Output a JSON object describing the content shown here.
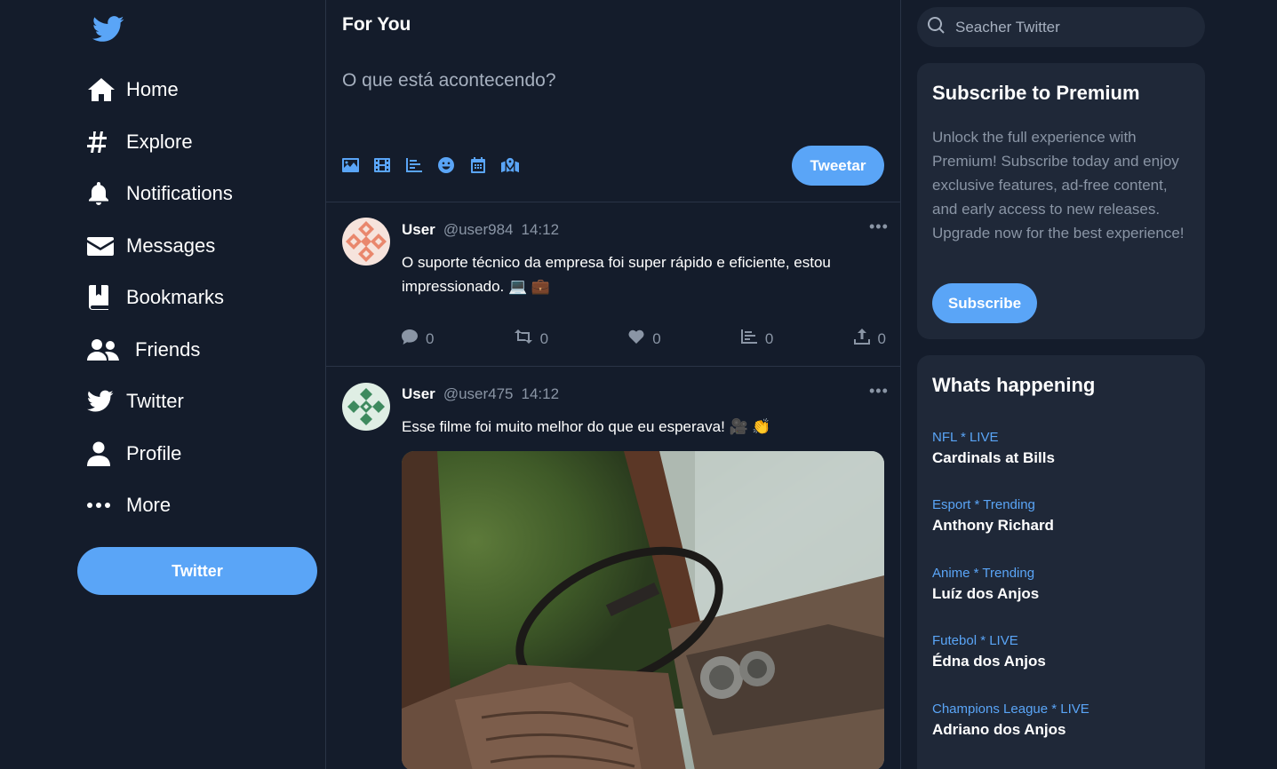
{
  "sidebar": {
    "items": [
      {
        "label": "Home",
        "icon": "home-icon"
      },
      {
        "label": "Explore",
        "icon": "hashtag-icon"
      },
      {
        "label": "Notifications",
        "icon": "bell-icon"
      },
      {
        "label": "Messages",
        "icon": "envelope-icon"
      },
      {
        "label": "Bookmarks",
        "icon": "bookmark-icon"
      },
      {
        "label": "Friends",
        "icon": "friends-icon"
      },
      {
        "label": "Twitter",
        "icon": "twitter-icon"
      },
      {
        "label": "Profile",
        "icon": "user-icon"
      },
      {
        "label": "More",
        "icon": "more-icon"
      }
    ],
    "button_label": "Twitter"
  },
  "feed": {
    "title": "For You",
    "compose_placeholder": "O que está acontecendo?",
    "tweet_button": "Tweetar",
    "posts": [
      {
        "name": "User",
        "handle": "@user984",
        "time": "14:12",
        "text": "O suporte técnico da empresa foi super rápido e eficiente, estou impressionado. 💻 💼",
        "replies": "0",
        "retweets": "0",
        "likes": "0",
        "views": "0",
        "shares": "0"
      },
      {
        "name": "User",
        "handle": "@user475",
        "time": "14:12",
        "text": "Esse filme foi muito melhor do que eu esperava! 🎥 👏"
      }
    ]
  },
  "search": {
    "placeholder": "Seacher Twitter"
  },
  "premium": {
    "title": "Subscribe to Premium",
    "text": "Unlock the full experience with Premium! Subscribe today and enjoy exclusive features, ad-free content, and early access to new releases. Upgrade now for the best experience!",
    "button": "Subscribe"
  },
  "happening": {
    "title": "Whats happening",
    "trends": [
      {
        "category": "NFL * LIVE",
        "title": "Cardinals at Bills"
      },
      {
        "category": "Esport * Trending",
        "title": "Anthony Richard"
      },
      {
        "category": "Anime * Trending",
        "title": "Luíz dos Anjos"
      },
      {
        "category": "Futebol * LIVE",
        "title": "Édna dos Anjos"
      },
      {
        "category": "Champions League * LIVE",
        "title": "Adriano dos Anjos"
      }
    ]
  },
  "colors": {
    "background": "#141c2b",
    "card": "#1f2838",
    "accent": "#5aa5f7",
    "muted": "#8a95a5"
  }
}
